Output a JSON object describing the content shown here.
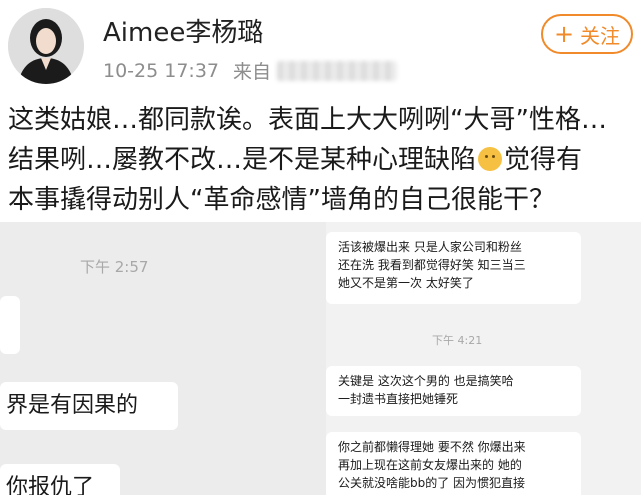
{
  "header": {
    "username": "Aimee李杨璐",
    "timestamp": "10-25 17:37",
    "source_label": "来自",
    "follow_label": "关注",
    "follow_icon": "plus-icon"
  },
  "post": {
    "line1": "这类姑娘…都同款诶。表面上大大咧咧“大哥”性格…",
    "line2a": "结果咧…屡教不改…是不是某种心理缺陷",
    "emoji": "thinking-face-emoji",
    "line2b": "觉得有",
    "line3": "本事撬得动别人“革命感情”墙角的自己很能干？"
  },
  "screenshot": {
    "left_time": "下午 2:57",
    "left_bubble_2": "界是有因果的",
    "left_bubble_3": "你报仇了",
    "right_time": "下午 4:21",
    "right_bubble_1": [
      "活该被爆出来 只是人家公司和粉丝",
      "还在洗 我看到都觉得好笑 知三当三",
      "她又不是第一次 太好笑了"
    ],
    "right_bubble_2": [
      "关键是 这次这个男的 也是搞笑哈",
      "一封遗书直接把她锤死"
    ],
    "right_bubble_3": [
      "你之前都懒得理她 要不然 你爆出来",
      "再加上现在这前女友爆出来的 她的",
      "公关就没啥能bb的了 因为惯犯直接"
    ]
  }
}
